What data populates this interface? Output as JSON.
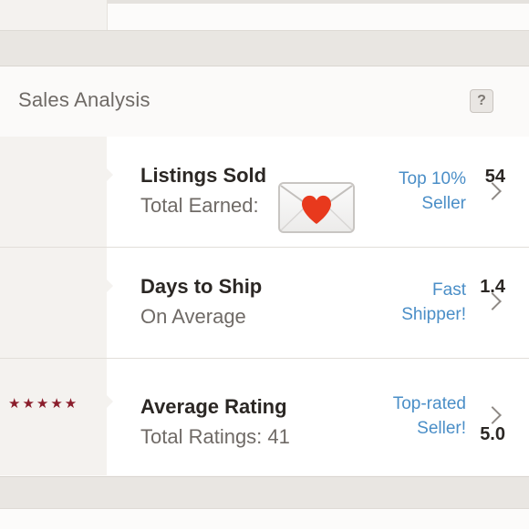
{
  "header": {
    "title": "Sales Analysis",
    "help_label": "?"
  },
  "rows": [
    {
      "metric": "54",
      "title": "Listings Sold",
      "subtitle": "Total Earned:",
      "badge_line1": "Top 10%",
      "badge_line2": "Seller",
      "icon": "love-letter-emoji"
    },
    {
      "metric": "1.4",
      "title": "Days to Ship",
      "subtitle": "On Average",
      "badge_line1": "Fast",
      "badge_line2": "Shipper!"
    },
    {
      "metric": "5.0",
      "stars": "★★★★★",
      "rating": 5,
      "rating_max": 5,
      "title": "Average Rating",
      "subtitle": "Total Ratings: 41",
      "badge_line1": "Top-rated",
      "badge_line2": "Seller!"
    }
  ],
  "colors": {
    "accent_link": "#4a8ec7",
    "star": "#8a1d2b",
    "text_dark": "#2b2724",
    "text_muted": "#6f6a66"
  }
}
